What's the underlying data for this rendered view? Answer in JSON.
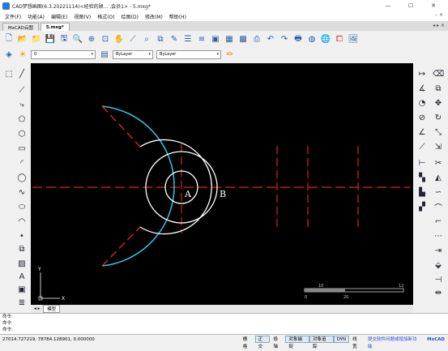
{
  "window": {
    "title": "CAD梦想画图(6.3.20221114)<经验的顾... ,会员1> - 5.mxg*",
    "controls": [
      "—",
      "☐",
      "✕"
    ]
  },
  "menu": {
    "items": [
      "文件(F)",
      "功能(A)",
      "编辑(E)",
      "视图(V)",
      "格式(O)",
      "绘图(D)",
      "修改(M)",
      "帮助(H)"
    ],
    "right": "– ×"
  },
  "tabs": {
    "items": [
      "MxCAD云图",
      "5.mxg*"
    ],
    "nav": "◂ ▸ ×"
  },
  "layer_bar": {
    "layer_value": "0",
    "color_value": "ByLayer",
    "linetype_value": "ByLayer"
  },
  "canvas": {
    "label_a": "A",
    "label_b": "B",
    "ucs_y": "Y",
    "ucs_x": "X",
    "scale_top_left": "10",
    "scale_top_right": "12",
    "scale_bottom": "0",
    "scale_bottom_mid": "20"
  },
  "layout_tabs": {
    "nav": "◂ ▸",
    "items": [
      "模型"
    ]
  },
  "command": {
    "lines": [
      "命令:",
      "命令:",
      "命令:"
    ]
  },
  "status": {
    "coords": "27014.727219,  78784.128901,  0.000000",
    "toggles": [
      {
        "label": "栅格",
        "on": false
      },
      {
        "label": "正交",
        "on": true
      },
      {
        "label": "极轴",
        "on": false
      },
      {
        "label": "对象捕捉",
        "on": true
      },
      {
        "label": "对象追踪",
        "on": true
      },
      {
        "label": "DYN",
        "on": true
      },
      {
        "label": "线宽",
        "on": false
      }
    ],
    "promo": "提交软件问题或增加新功能",
    "brand": "MxCAD"
  },
  "colors": {
    "canvas_bg": "#000000",
    "line_red": "#e02020",
    "line_white": "#ffffff",
    "line_cyan": "#2ec8e8",
    "accent": "#2b5c9e"
  }
}
